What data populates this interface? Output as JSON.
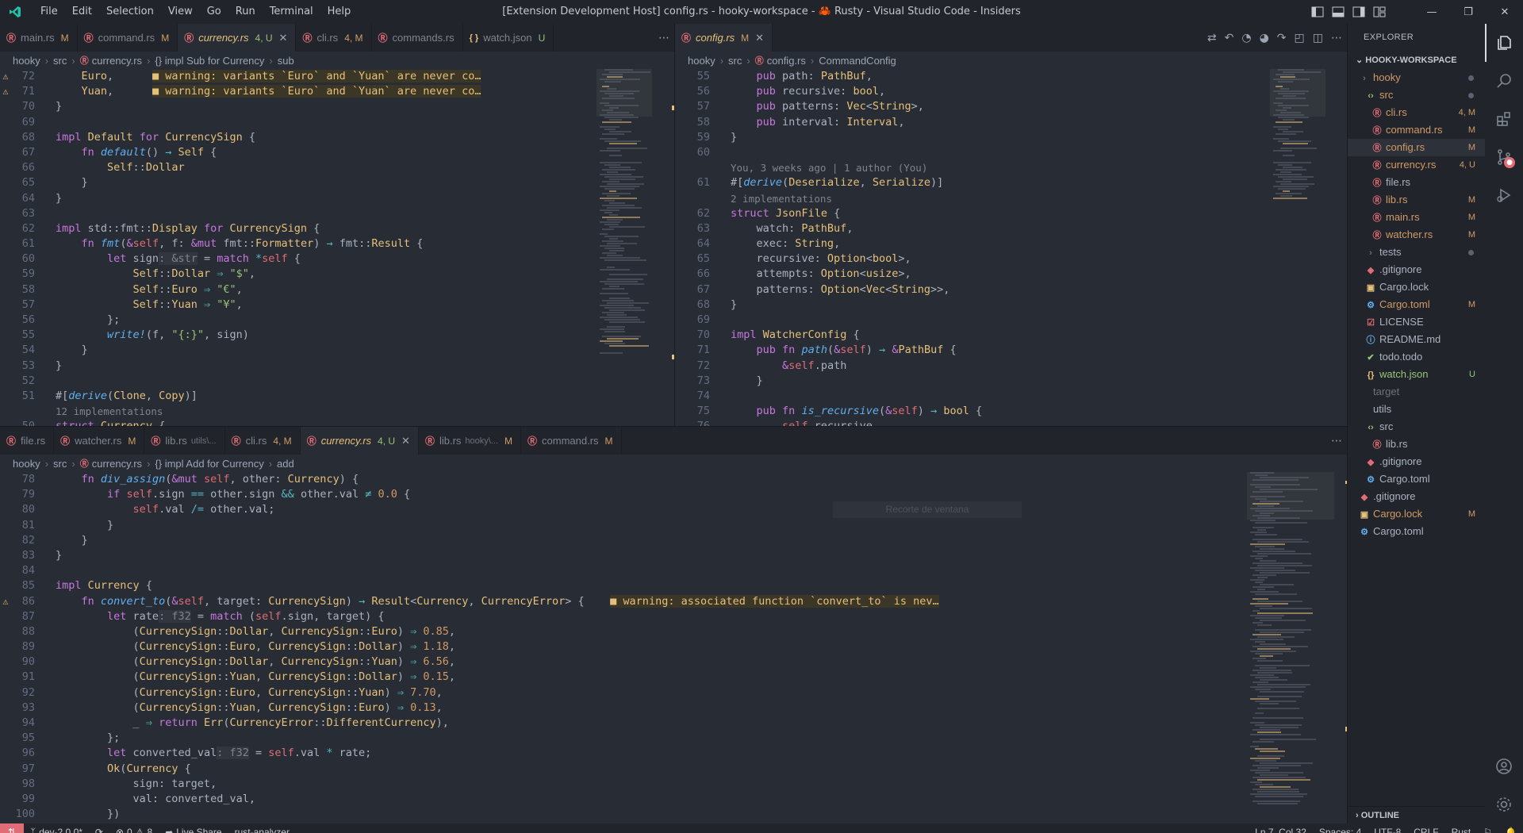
{
  "app": {
    "title": "[Extension Development Host] config.rs - hooky-workspace - 🦀 Rusty - Visual Studio Code - Insiders"
  },
  "menu": [
    "File",
    "Edit",
    "Selection",
    "View",
    "Go",
    "Run",
    "Terminal",
    "Help"
  ],
  "colors": {
    "accent": "#e06c75",
    "warning": "#e5c07b",
    "keyword": "#c678dd",
    "type": "#e5c07b",
    "function": "#61afef",
    "string": "#98c379",
    "number": "#d19a66",
    "modified": "#d19a66",
    "untracked": "#98c379"
  },
  "topLeftPane": {
    "tabs": [
      {
        "label": "main.rs",
        "status": "M"
      },
      {
        "label": "command.rs",
        "status": "M"
      },
      {
        "label": "currency.rs",
        "status": "4, U",
        "active": true
      },
      {
        "label": "cli.rs",
        "status": "4, M"
      },
      {
        "label": "commands.rs",
        "status": ""
      },
      {
        "label": "watch.json",
        "status": "U",
        "json": true
      }
    ],
    "breadcrumb": [
      "hooky",
      "src",
      "currency.rs",
      "{} impl Sub for Currency",
      "sub"
    ]
  },
  "topRightPane": {
    "tabs": [
      {
        "label": "config.rs",
        "status": "M",
        "active": true
      }
    ],
    "breadcrumb": [
      "hooky",
      "src",
      "config.rs",
      "CommandConfig"
    ]
  },
  "bottomPane": {
    "tabs": [
      {
        "label": "file.rs",
        "status": ""
      },
      {
        "label": "watcher.rs",
        "status": "M"
      },
      {
        "label": "lib.rs",
        "desc": "utils\\...",
        "status": ""
      },
      {
        "label": "cli.rs",
        "status": "4, M"
      },
      {
        "label": "currency.rs",
        "status": "4, U",
        "active": true
      },
      {
        "label": "lib.rs",
        "desc": "hooky\\...",
        "status": "M"
      },
      {
        "label": "command.rs",
        "status": "M"
      }
    ],
    "breadcrumb": [
      "hooky",
      "src",
      "currency.rs",
      "{} impl Add for Currency",
      "add"
    ],
    "ghost": "Recorte de ventana"
  },
  "explorer": {
    "title": "EXPLORER",
    "workspace": "HOOKY-WORKSPACE",
    "items": [
      {
        "label": "hooky",
        "status": "",
        "indent": 1,
        "kind": "folder",
        "color": "#d19a66",
        "dot": true
      },
      {
        "label": "src",
        "status": "",
        "indent": 2,
        "kind": "folder-src",
        "color": "#d19a66",
        "dot": true
      },
      {
        "label": "cli.rs",
        "status": "4, M",
        "indent": 3,
        "kind": "rs",
        "color": "#d19a66"
      },
      {
        "label": "command.rs",
        "status": "M",
        "indent": 3,
        "kind": "rs",
        "color": "#d19a66"
      },
      {
        "label": "config.rs",
        "status": "M",
        "indent": 3,
        "kind": "rs",
        "color": "#d19a66",
        "sel": true
      },
      {
        "label": "currency.rs",
        "status": "4, U",
        "indent": 3,
        "kind": "rs",
        "color": "#d19a66"
      },
      {
        "label": "file.rs",
        "status": "",
        "indent": 3,
        "kind": "rs",
        "color": "#abb2bf"
      },
      {
        "label": "lib.rs",
        "status": "M",
        "indent": 3,
        "kind": "rs",
        "color": "#d19a66"
      },
      {
        "label": "main.rs",
        "status": "M",
        "indent": 3,
        "kind": "rs",
        "color": "#d19a66"
      },
      {
        "label": "watcher.rs",
        "status": "M",
        "indent": 3,
        "kind": "rs",
        "color": "#d19a66"
      },
      {
        "label": "tests",
        "status": "",
        "indent": 2,
        "kind": "folder",
        "color": "#abb2bf",
        "dot": true
      },
      {
        "label": ".gitignore",
        "status": "",
        "indent": 2,
        "kind": "git",
        "color": "#abb2bf"
      },
      {
        "label": "Cargo.lock",
        "status": "",
        "indent": 2,
        "kind": "lock",
        "color": "#abb2bf"
      },
      {
        "label": "Cargo.toml",
        "status": "M",
        "indent": 2,
        "kind": "gear",
        "color": "#d19a66"
      },
      {
        "label": "LICENSE",
        "status": "",
        "indent": 2,
        "kind": "license",
        "color": "#abb2bf"
      },
      {
        "label": "README.md",
        "status": "",
        "indent": 2,
        "kind": "info",
        "color": "#abb2bf"
      },
      {
        "label": "todo.todo",
        "status": "",
        "indent": 2,
        "kind": "check",
        "color": "#abb2bf"
      },
      {
        "label": "watch.json",
        "status": "U",
        "indent": 2,
        "kind": "json",
        "color": "#98c379"
      },
      {
        "label": "target",
        "status": "",
        "indent": 1,
        "kind": "none",
        "color": "#6b717d"
      },
      {
        "label": "utils",
        "status": "",
        "indent": 1,
        "kind": "none",
        "color": "#abb2bf"
      },
      {
        "label": "src",
        "status": "",
        "indent": 2,
        "kind": "folder-src",
        "color": "#abb2bf"
      },
      {
        "label": "lib.rs",
        "status": "",
        "indent": 3,
        "kind": "rs",
        "color": "#abb2bf"
      },
      {
        "label": ".gitignore",
        "status": "",
        "indent": 2,
        "kind": "git",
        "color": "#abb2bf"
      },
      {
        "label": "Cargo.toml",
        "status": "",
        "indent": 2,
        "kind": "gear",
        "color": "#abb2bf"
      },
      {
        "label": ".gitignore",
        "status": "",
        "indent": 1,
        "kind": "git",
        "color": "#abb2bf"
      },
      {
        "label": "Cargo.lock",
        "status": "M",
        "indent": 1,
        "kind": "lock",
        "color": "#d19a66"
      },
      {
        "label": "Cargo.toml",
        "status": "",
        "indent": 1,
        "kind": "gear",
        "color": "#abb2bf"
      }
    ],
    "outline": "OUTLINE"
  },
  "status": {
    "branch": "dev-2.0.0*",
    "errors": "0",
    "warnings": "8",
    "liveshare": "Live Share",
    "analyzer": "rust-analyzer",
    "position": "Ln 7, Col 32",
    "spaces": "Spaces: 4",
    "encoding": "UTF-8",
    "eol": "CRLF",
    "language": "Rust"
  },
  "code": {
    "topLeft": [
      {
        "n": "72",
        "w": true,
        "h": "    <span class=\"t\">Euro</span>,      <span class=\"inline-warn\">■ warning: variants `Euro` and `Yuan` are never co…</span>"
      },
      {
        "n": "71",
        "w": true,
        "h": "    <span class=\"t\">Yuan</span>,      <span class=\"inline-warn\">■ warning: variants `Euro` and `Yuan` are never co…</span>"
      },
      {
        "n": "70",
        "h": "}"
      },
      {
        "n": "69",
        "h": ""
      },
      {
        "n": "68",
        "h": "<span class=\"k\">impl</span> <span class=\"t\">Default</span> <span class=\"k\">for</span> <span class=\"t\">CurrencySign</span> {"
      },
      {
        "n": "67",
        "h": "    <span class=\"k\">fn</span> <span class=\"m\">default</span>() <span class=\"c\">→</span> <span class=\"t\">Self</span> {"
      },
      {
        "n": "66",
        "h": "        <span class=\"t\">Self</span>::<span class=\"t\">Dollar</span>"
      },
      {
        "n": "65",
        "h": "    }"
      },
      {
        "n": "64",
        "h": "}"
      },
      {
        "n": "63",
        "h": ""
      },
      {
        "n": "62",
        "h": "<span class=\"k\">impl</span> std::fmt::<span class=\"t\">Display</span> <span class=\"k\">for</span> <span class=\"t\">CurrencySign</span> {"
      },
      {
        "n": "61",
        "h": "    <span class=\"k\">fn</span> <span class=\"m\">fmt</span>(<span class=\"k\">&amp;</span><span class=\"p\">self</span>, f: <span class=\"k\">&amp;mut</span> fmt::<span class=\"t\">Formatter</span>) <span class=\"c\">→</span> fmt::<span class=\"t\">Result</span> {"
      },
      {
        "n": "60",
        "h": "        <span class=\"k\">let</span> sign<span class=\"inlay\">: &amp;str</span> = <span class=\"k\">match</span> <span class=\"c\">*</span><span class=\"p\">self</span> {"
      },
      {
        "n": "59",
        "h": "            <span class=\"t\">Self</span>::<span class=\"t\">Dollar</span> <span class=\"c\">⇒</span> <span class=\"s\">\"$\"</span>,"
      },
      {
        "n": "58",
        "h": "            <span class=\"t\">Self</span>::<span class=\"t\">Euro</span> <span class=\"c\">⇒</span> <span class=\"s\">\"€\"</span>,"
      },
      {
        "n": "57",
        "h": "            <span class=\"t\">Self</span>::<span class=\"t\">Yuan</span> <span class=\"c\">⇒</span> <span class=\"s\">\"¥\"</span>,"
      },
      {
        "n": "56",
        "h": "        };"
      },
      {
        "n": "55",
        "h": "        <span class=\"m\">write!</span>(f, <span class=\"s\">\"{:}\"</span>, sign)"
      },
      {
        "n": "54",
        "h": "    }"
      },
      {
        "n": "53",
        "h": "}"
      },
      {
        "n": "52",
        "h": ""
      },
      {
        "n": "51",
        "h": "#[<span class=\"m\">derive</span>(<span class=\"t\">Clone</span>, <span class=\"t\">Copy</span>)]"
      },
      {
        "n": "",
        "lens": true,
        "h": "12 implementations"
      },
      {
        "n": "50",
        "h": "<span class=\"k\">struct</span> <span class=\"t\">Currency</span> {"
      }
    ],
    "topRight": [
      {
        "n": "55",
        "h": "    <span class=\"k\">pub</span> path: <span class=\"t\">PathBuf</span>,"
      },
      {
        "n": "56",
        "h": "    <span class=\"k\">pub</span> recursive: <span class=\"t\">bool</span>,"
      },
      {
        "n": "57",
        "h": "    <span class=\"k\">pub</span> patterns: <span class=\"t\">Vec</span>&lt;<span class=\"t\">String</span>&gt;,"
      },
      {
        "n": "58",
        "h": "    <span class=\"k\">pub</span> interval: <span class=\"t\">Interval</span>,"
      },
      {
        "n": "59",
        "h": "}"
      },
      {
        "n": "60",
        "h": ""
      },
      {
        "n": "",
        "lens": true,
        "h": "You, 3 weeks ago | 1 author (You)"
      },
      {
        "n": "61",
        "h": "#[<span class=\"m\">derive</span>(<span class=\"t\">Deserialize</span>, <span class=\"t\">Serialize</span>)]"
      },
      {
        "n": "",
        "lens": true,
        "h": "2 implementations"
      },
      {
        "n": "62",
        "h": "<span class=\"k\">struct</span> <span class=\"t\">JsonFile</span> {"
      },
      {
        "n": "63",
        "h": "    watch: <span class=\"t\">PathBuf</span>,"
      },
      {
        "n": "64",
        "h": "    exec: <span class=\"t\">String</span>,"
      },
      {
        "n": "65",
        "h": "    recursive: <span class=\"t\">Option</span>&lt;<span class=\"t\">bool</span>&gt;,"
      },
      {
        "n": "66",
        "h": "    attempts: <span class=\"t\">Option</span>&lt;<span class=\"t\">usize</span>&gt;,"
      },
      {
        "n": "67",
        "h": "    patterns: <span class=\"t\">Option</span>&lt;<span class=\"t\">Vec</span>&lt;<span class=\"t\">String</span>&gt;&gt;,"
      },
      {
        "n": "68",
        "h": "}"
      },
      {
        "n": "69",
        "h": ""
      },
      {
        "n": "70",
        "h": "<span class=\"k\">impl</span> <span class=\"t\">WatcherConfig</span> {"
      },
      {
        "n": "71",
        "h": "    <span class=\"k\">pub</span> <span class=\"k\">fn</span> <span class=\"m\">path</span>(<span class=\"k\">&amp;</span><span class=\"p\">self</span>) <span class=\"c\">→</span> <span class=\"k\">&amp;</span><span class=\"t\">PathBuf</span> {"
      },
      {
        "n": "72",
        "h": "        <span class=\"k\">&amp;</span><span class=\"p\">self</span>.path"
      },
      {
        "n": "73",
        "h": "    }"
      },
      {
        "n": "74",
        "h": ""
      },
      {
        "n": "75",
        "h": "    <span class=\"k\">pub</span> <span class=\"k\">fn</span> <span class=\"m\">is_recursive</span>(<span class=\"k\">&amp;</span><span class=\"p\">self</span>) <span class=\"c\">→</span> <span class=\"t\">bool</span> {"
      },
      {
        "n": "76",
        "h": "        <span class=\"p\">self</span>.recursive"
      }
    ],
    "bottom": [
      {
        "n": "78",
        "h": "    <span class=\"k\">fn</span> <span class=\"m\">div_assign</span>(<span class=\"k\">&amp;mut</span> <span class=\"p\">self</span>, other: <span class=\"t\">Currency</span>) {"
      },
      {
        "n": "79",
        "h": "        <span class=\"k\">if</span> <span class=\"p\">self</span>.sign <span class=\"c\">==</span> other.sign <span class=\"c\">&amp;&amp;</span> other.val <span class=\"c\">≠</span> <span class=\"n\">0.0</span> {"
      },
      {
        "n": "80",
        "h": "            <span class=\"p\">self</span>.val <span class=\"c\">/=</span> other.val;"
      },
      {
        "n": "81",
        "h": "        }"
      },
      {
        "n": "82",
        "h": "    }"
      },
      {
        "n": "83",
        "h": "}"
      },
      {
        "n": "84",
        "h": ""
      },
      {
        "n": "85",
        "h": "<span class=\"k\">impl</span> <span class=\"t\">Currency</span> {"
      },
      {
        "n": "86",
        "w": true,
        "h": "    <span class=\"k\">fn</span> <span class=\"m\">convert_to</span>(<span class=\"k\">&amp;</span><span class=\"p\">self</span>, target: <span class=\"t\">CurrencySign</span>) <span class=\"c\">→</span> <span class=\"t\">Result</span>&lt;<span class=\"t\">Currency</span>, <span class=\"t\">CurrencyError</span>&gt; {    <span class=\"inline-warn\">■ warning: associated function `convert_to` is nev…</span>"
      },
      {
        "n": "87",
        "h": "        <span class=\"k\">let</span> rate<span class=\"inlay\">: f32</span> = <span class=\"k\">match</span> (<span class=\"p\">self</span>.sign, target) {"
      },
      {
        "n": "88",
        "h": "            (<span class=\"t\">CurrencySign</span>::<span class=\"t\">Dollar</span>, <span class=\"t\">CurrencySign</span>::<span class=\"t\">Euro</span>) <span class=\"c\">⇒</span> <span class=\"n\">0.85</span>,"
      },
      {
        "n": "89",
        "h": "            (<span class=\"t\">CurrencySign</span>::<span class=\"t\">Euro</span>, <span class=\"t\">CurrencySign</span>::<span class=\"t\">Dollar</span>) <span class=\"c\">⇒</span> <span class=\"n\">1.18</span>,"
      },
      {
        "n": "90",
        "h": "            (<span class=\"t\">CurrencySign</span>::<span class=\"t\">Dollar</span>, <span class=\"t\">CurrencySign</span>::<span class=\"t\">Yuan</span>) <span class=\"c\">⇒</span> <span class=\"n\">6.56</span>,"
      },
      {
        "n": "91",
        "h": "            (<span class=\"t\">CurrencySign</span>::<span class=\"t\">Yuan</span>, <span class=\"t\">CurrencySign</span>::<span class=\"t\">Dollar</span>) <span class=\"c\">⇒</span> <span class=\"n\">0.15</span>,"
      },
      {
        "n": "92",
        "h": "            (<span class=\"t\">CurrencySign</span>::<span class=\"t\">Euro</span>, <span class=\"t\">CurrencySign</span>::<span class=\"t\">Yuan</span>) <span class=\"c\">⇒</span> <span class=\"n\">7.70</span>,"
      },
      {
        "n": "93",
        "h": "            (<span class=\"t\">CurrencySign</span>::<span class=\"t\">Yuan</span>, <span class=\"t\">CurrencySign</span>::<span class=\"t\">Euro</span>) <span class=\"c\">⇒</span> <span class=\"n\">0.13</span>,"
      },
      {
        "n": "94",
        "h": "            _ <span class=\"c\">⇒</span> <span class=\"k\">return</span> <span class=\"t\">Err</span>(<span class=\"t\">CurrencyError</span>::<span class=\"t\">DifferentCurrency</span>),"
      },
      {
        "n": "95",
        "h": "        };"
      },
      {
        "n": "96",
        "h": "        <span class=\"k\">let</span> converted_val<span class=\"inlay\">: f32</span> = <span class=\"p\">self</span>.val <span class=\"c\">*</span> rate;"
      },
      {
        "n": "97",
        "h": "        <span class=\"t\">Ok</span>(<span class=\"t\">Currency</span> {"
      },
      {
        "n": "98",
        "h": "            sign: target,"
      },
      {
        "n": "99",
        "h": "            val: converted_val,"
      },
      {
        "n": "100",
        "h": "        })"
      }
    ]
  }
}
